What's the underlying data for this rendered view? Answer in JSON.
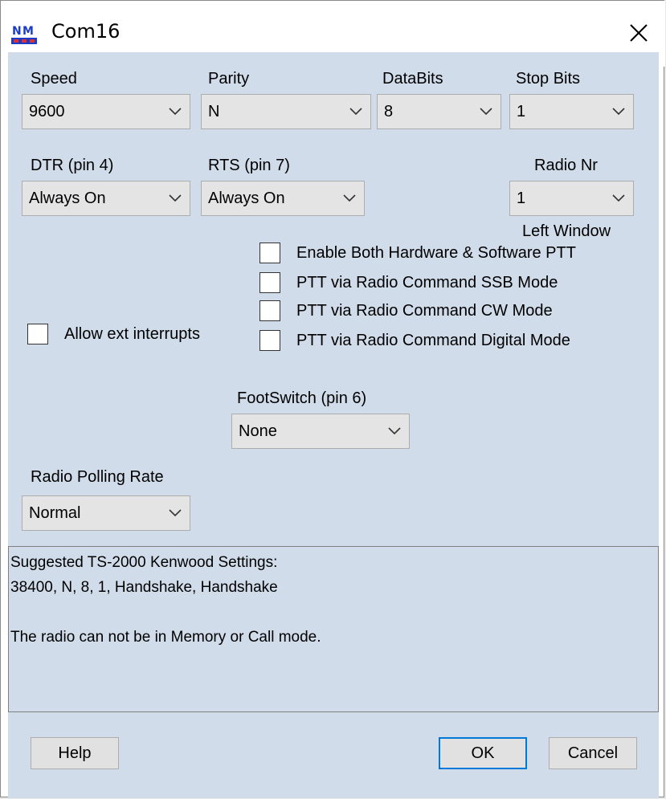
{
  "window": {
    "title": "Com16"
  },
  "icons": {
    "app": "nm-logo-icon",
    "close": "close-icon",
    "chevron": "chevron-down-icon"
  },
  "colors": {
    "client_bg": "#d1dcea",
    "accent": "#0078d7"
  },
  "serial": {
    "speed": {
      "label": "Speed",
      "value": "9600"
    },
    "parity": {
      "label": "Parity",
      "value": "N"
    },
    "databits": {
      "label": "DataBits",
      "value": "8"
    },
    "stopbits": {
      "label": "Stop Bits",
      "value": "1"
    },
    "dtr": {
      "label": "DTR (pin 4)",
      "value": "Always On"
    },
    "rts": {
      "label": "RTS (pin 7)",
      "value": "Always On"
    },
    "radio_nr": {
      "label": "Radio Nr",
      "value": "1",
      "note": "Left Window"
    }
  },
  "options": {
    "allow_ext_interrupts": {
      "label": "Allow ext interrupts",
      "checked": false
    },
    "ptt": [
      {
        "label": "Enable Both Hardware & Software PTT",
        "checked": false
      },
      {
        "label": "PTT via Radio Command SSB Mode",
        "checked": false
      },
      {
        "label": "PTT via Radio Command CW Mode",
        "checked": false
      },
      {
        "label": "PTT via Radio Command Digital Mode",
        "checked": false
      }
    ]
  },
  "footswitch": {
    "label": "FootSwitch (pin 6)",
    "value": "None"
  },
  "polling": {
    "label": "Radio Polling Rate",
    "value": "Normal"
  },
  "info": {
    "lines": [
      "Suggested TS-2000 Kenwood Settings:",
      "38400, N, 8, 1, Handshake, Handshake",
      "",
      "The radio can not be in Memory or Call mode."
    ]
  },
  "buttons": {
    "help": "Help",
    "ok": "OK",
    "cancel": "Cancel"
  }
}
